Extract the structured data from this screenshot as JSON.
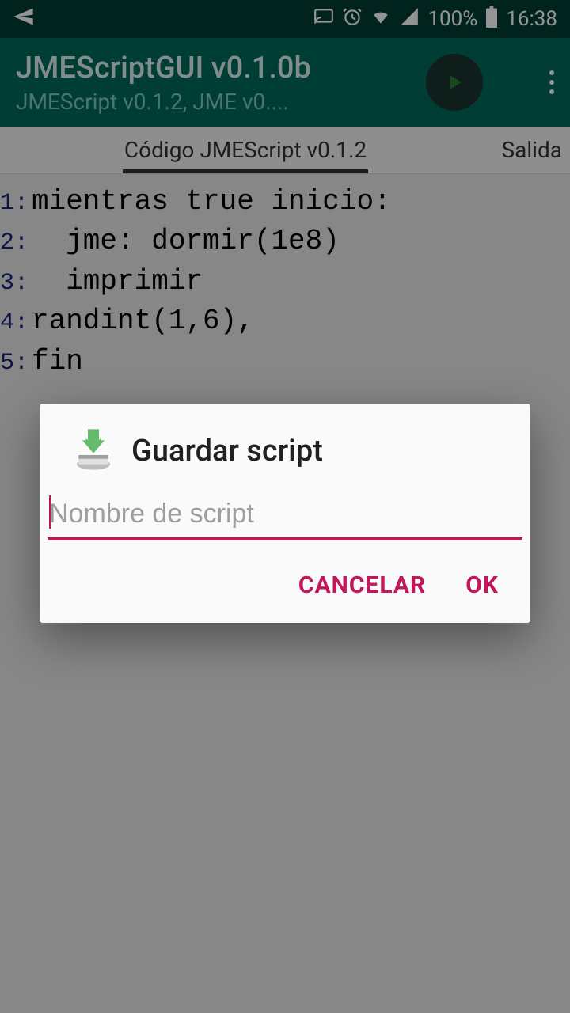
{
  "status": {
    "battery": "100%",
    "time": "16:38"
  },
  "app": {
    "title": "JMEScriptGUI v0.1.0b",
    "subtitle": "JMEScript v0.1.2, JME v0...."
  },
  "tabs": {
    "code": "Código JMEScript v0.1.2",
    "output": "Salida"
  },
  "code": {
    "lines": [
      {
        "num": "1:",
        "text": "mientras true inicio:"
      },
      {
        "num": "2:",
        "text": "  jme: dormir(1e8)"
      },
      {
        "num": "3:",
        "text": "  imprimir"
      },
      {
        "num": "4:",
        "text": "randint(1,6),"
      },
      {
        "num": "5:",
        "text": "fin"
      }
    ]
  },
  "dialog": {
    "title": "Guardar script",
    "placeholder": "Nombre de script",
    "cancel": "CANCELAR",
    "ok": "OK"
  }
}
